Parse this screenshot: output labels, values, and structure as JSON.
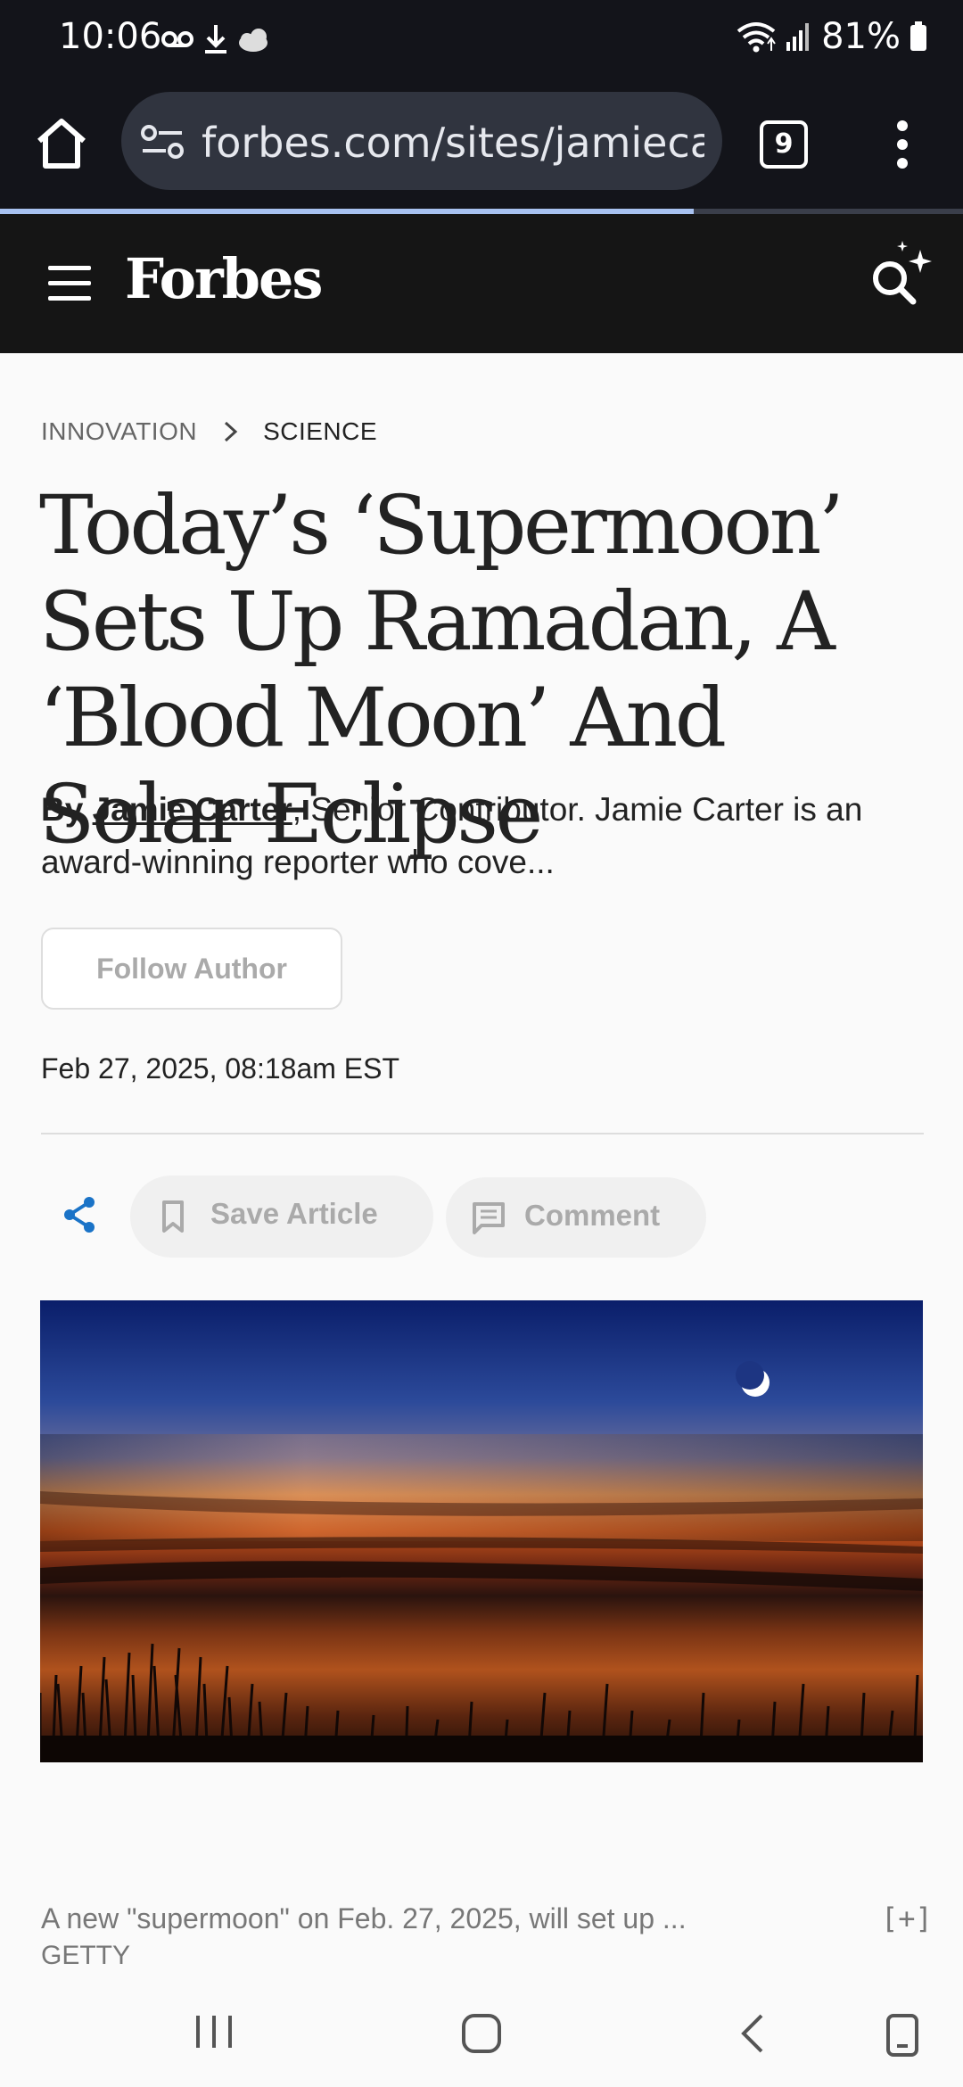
{
  "status_bar": {
    "time": "10:06",
    "battery": "81%",
    "icons": [
      "voicemail-icon",
      "download-icon",
      "cloud-icon",
      "wifi-icon",
      "signal-icon",
      "battery-icon"
    ]
  },
  "browser": {
    "url": "forbes.com/sites/jamiecarte",
    "tab_count": "9",
    "load_progress": 0.72
  },
  "site": {
    "logo": "Forbes"
  },
  "article": {
    "breadcrumb": [
      "INNOVATION",
      "SCIENCE"
    ],
    "headline": "Today’s ‘Supermoon’ Sets Up Ramadan, A ‘Blood Moon’ And Solar Eclipse",
    "byline_prefix": "By",
    "author": "Jamie Carter",
    "byline_rest": ", Senior Contributor. Jamie Carter is an award-winning reporter who cove...",
    "follow_label": "Follow Author",
    "date": "Feb 27, 2025, 08:18am EST",
    "save_label": "Save Article",
    "comment_label": "Comment",
    "caption": "A new \"supermoon\" on Feb. 27, 2025, will set up ...",
    "credit": "GETTY",
    "expand_label": "[+]"
  },
  "colors": {
    "header_bg": "#151515",
    "browser_bg": "#13141a",
    "share_accent": "#1a73c7",
    "load_bar": "#a8c2f0"
  }
}
